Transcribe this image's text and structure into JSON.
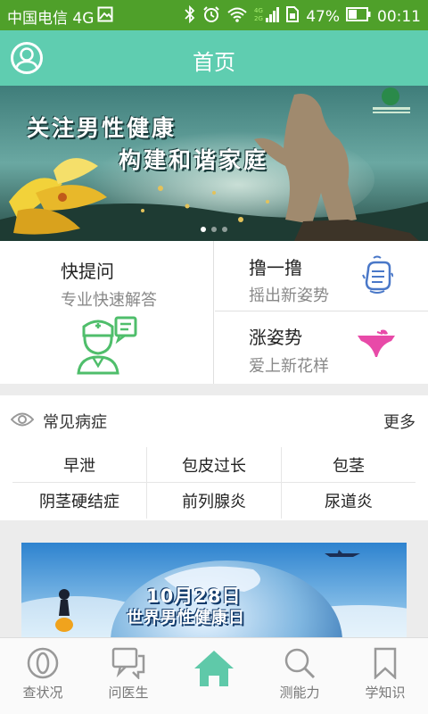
{
  "status_bar": {
    "carrier": "中国电信 4G",
    "battery": "47%",
    "time": "00:11"
  },
  "header": {
    "title": "首页"
  },
  "banner": {
    "line1": "关注男性健康",
    "line2": "构建和谐家庭",
    "slide_count": 3,
    "active_slide": 1
  },
  "features": {
    "quick_ask": {
      "title": "快提问",
      "subtitle": "专业快速解答"
    },
    "shake": {
      "title": "撸一撸",
      "subtitle": "摇出新姿势"
    },
    "positions": {
      "title": "涨姿势",
      "subtitle": "爱上新花样"
    }
  },
  "diseases": {
    "title": "常见病症",
    "more": "更多",
    "rows": [
      [
        "早泄",
        "包皮过长",
        "包茎"
      ],
      [
        "阴茎硬结症",
        "前列腺炎",
        "尿道炎"
      ]
    ]
  },
  "promo_banner": {
    "line1": "10月28日",
    "line2": "世界男性健康日"
  },
  "bottom_nav": {
    "items": [
      {
        "label": "查状况",
        "icon": "status-icon"
      },
      {
        "label": "问医生",
        "icon": "chat-icon"
      },
      {
        "label": "",
        "icon": "home-icon",
        "active": true
      },
      {
        "label": "测能力",
        "icon": "search-icon"
      },
      {
        "label": "学知识",
        "icon": "bookmark-icon"
      }
    ]
  },
  "colors": {
    "status_bar": "#4fa02a",
    "header": "#5fcdb0",
    "accent_green": "#4fbe6b",
    "accent_pink": "#e84aa8",
    "accent_blue": "#4a78c8",
    "home_active": "#5fc9a9"
  }
}
